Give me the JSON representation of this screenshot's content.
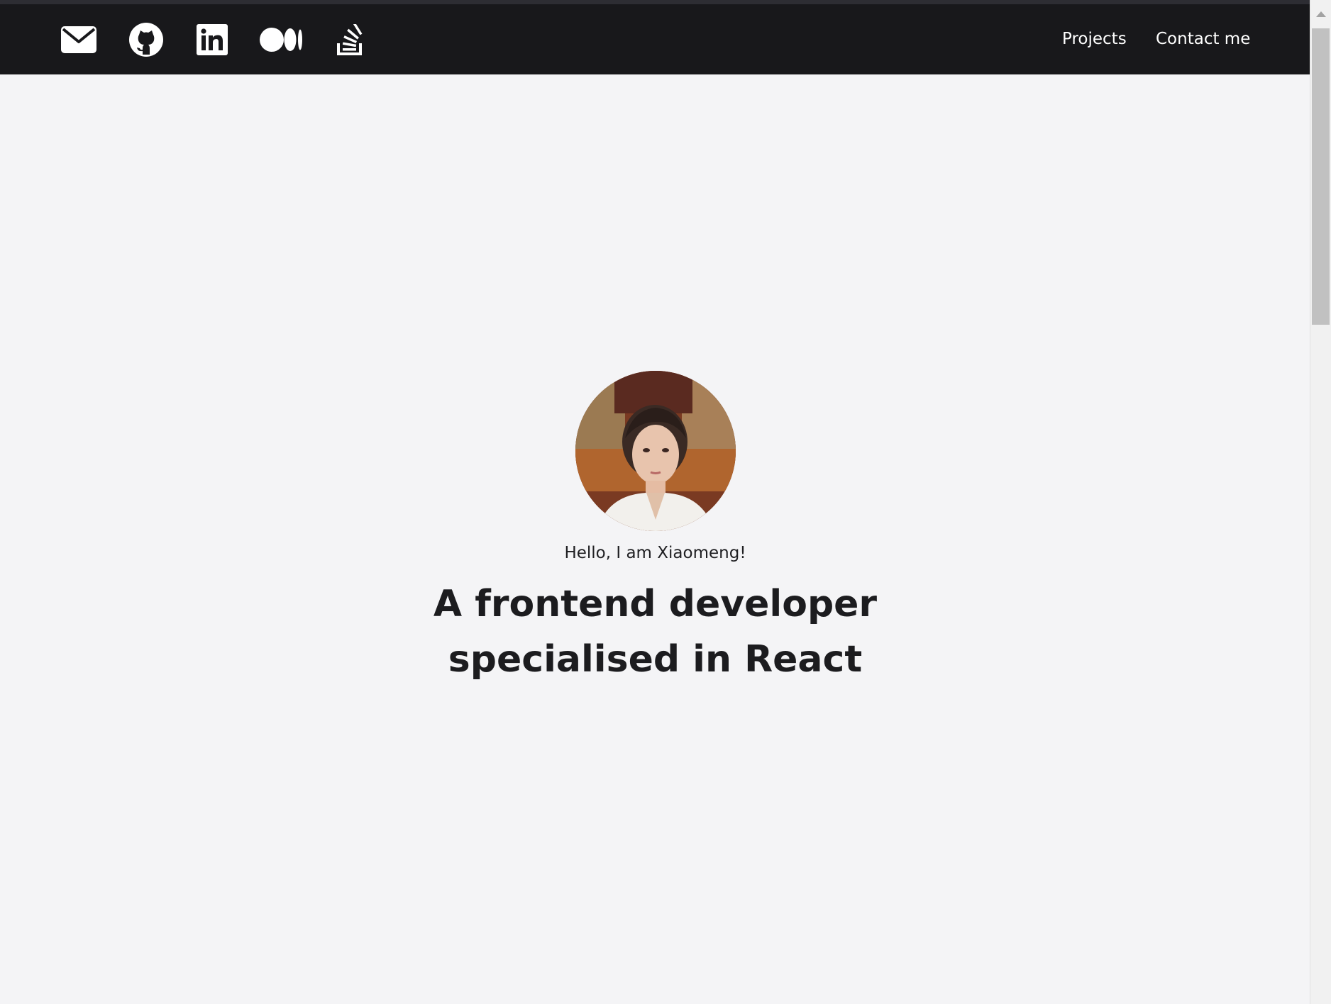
{
  "navbar": {
    "socials": [
      {
        "icon": "envelope-icon"
      },
      {
        "icon": "github-icon"
      },
      {
        "icon": "linkedin-icon"
      },
      {
        "icon": "medium-icon"
      },
      {
        "icon": "stack-overflow-icon"
      }
    ],
    "links": {
      "projects": "Projects",
      "contact": "Contact me"
    }
  },
  "hero": {
    "avatar": "profile-photo",
    "greeting": "Hello, I am Xiaomeng!",
    "headline": "A frontend developer specialised in React"
  },
  "colors": {
    "navbar_bg": "#18181b",
    "page_bg": "#f4f4f6",
    "nav_text": "#ffffff",
    "headline_text": "#1c1c1f"
  }
}
